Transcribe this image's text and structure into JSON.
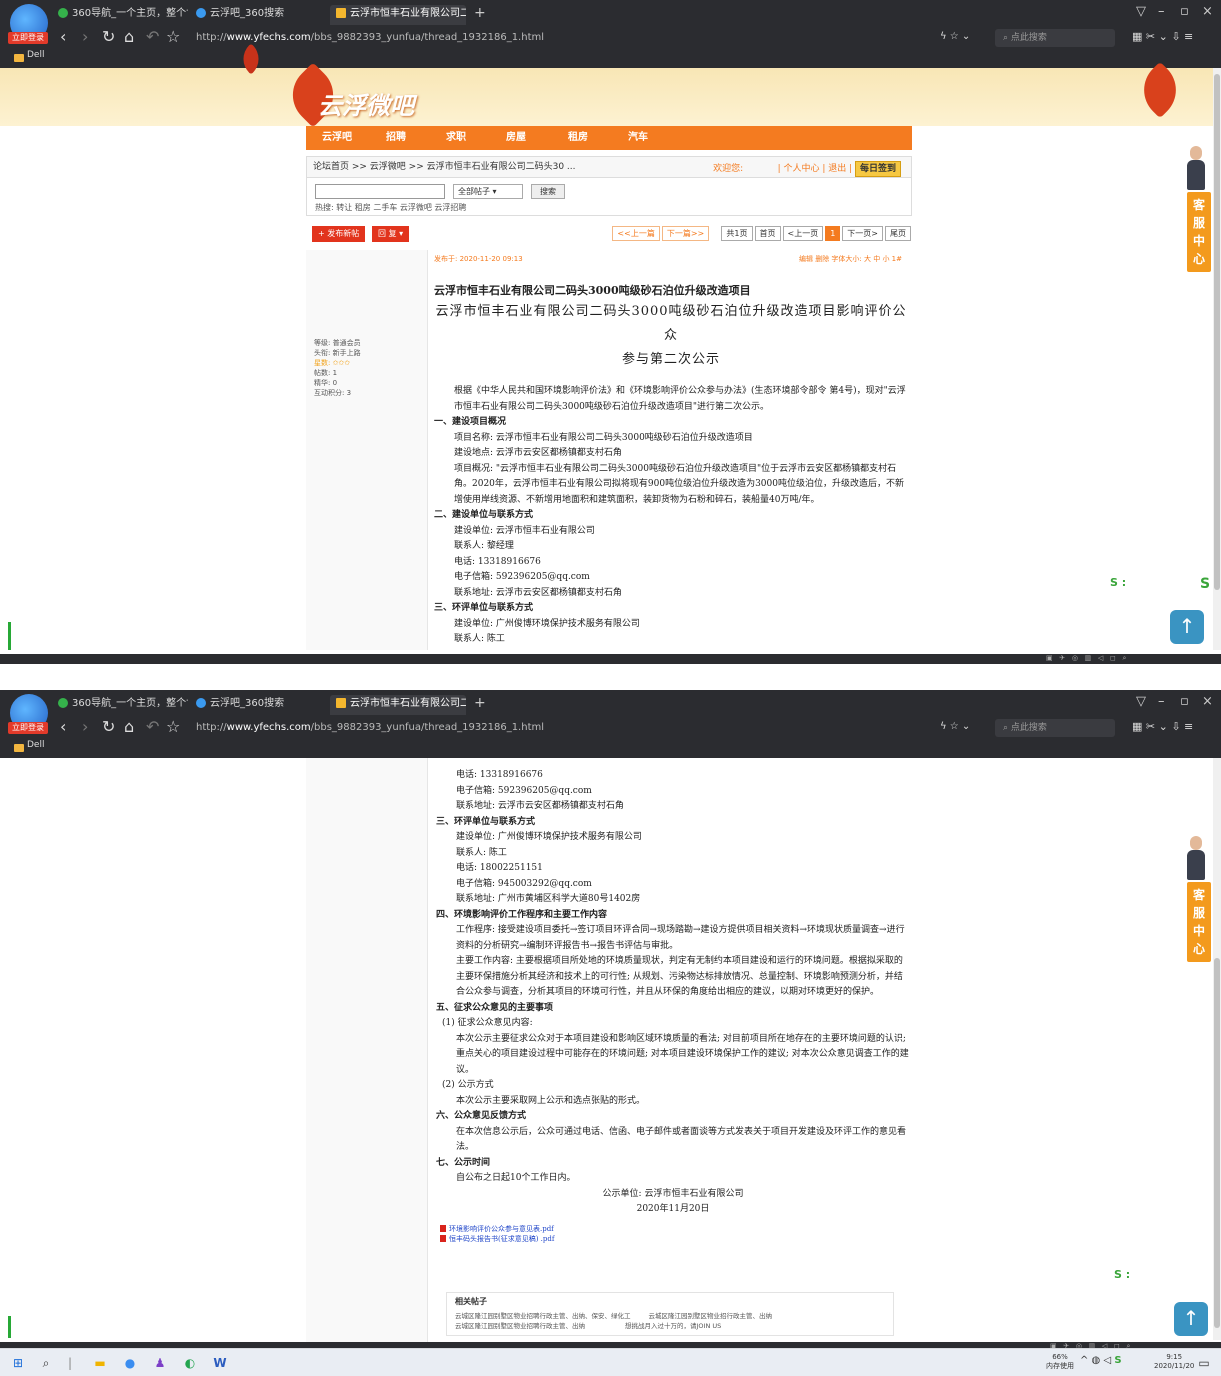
{
  "browser": {
    "login_badge": "立即登录",
    "tabs": [
      {
        "label": "360导航_一个主页，整个世界"
      },
      {
        "label": "云浮吧_360搜索"
      },
      {
        "label": "云浮市恒丰石业有限公司二码"
      }
    ],
    "url_prefix": "http://",
    "url_host": "www.yfechs.com",
    "url_path": "/bbs_9882393_yunfua/thread_1932186_1.html",
    "search_placeholder": "点此搜索",
    "bookmark": "Dell"
  },
  "site": {
    "banner_title": "云浮微吧",
    "nav": [
      "云浮吧",
      "招聘",
      "求职",
      "房屋",
      "租房",
      "汽车"
    ],
    "breadcrumb": "论坛首页 >> 云浮微吧 >> 云浮市恒丰石业有限公司二码头30 ...",
    "welcome": "欢迎您:",
    "user_center": "| 个人中心 | 退出 |",
    "checkin": "每日签到",
    "search_select": "全部帖子",
    "search_button": "搜索",
    "hot": "热搜:   转让  租房  二手车  云浮微吧  云浮招聘",
    "post_new": "+ 发布新帖",
    "reply": "回 复 ▾",
    "pager": [
      "<<上一篇",
      "下一篇>>",
      "共1页",
      "首页",
      "<上一页",
      "1",
      "下一页>",
      "尾页"
    ]
  },
  "user": {
    "lines": [
      "等级: 普通会员",
      "头衔: 新手上路",
      "星数: ✩✩✩",
      "帖数: 1",
      "精华: 0",
      "互动积分: 3"
    ]
  },
  "post": {
    "date": "发布于: 2020-11-20 09:13",
    "tools": "编辑  删除   字体大小: 大 中 小 1#",
    "title": "云浮市恒丰石业有限公司二码头3000吨级砂石泊位升级改造项目",
    "subtitle1": "云浮市恒丰石业有限公司二码头3000吨级砂石泊位升级改造项目影响评价公众",
    "subtitle2": "参与第二次公示",
    "intro": "根据《中华人民共和国环境影响评价法》和《环境影响评价公众参与办法》(生态环境部令部令 第4号)，现对\"云浮市恒丰石业有限公司二码头3000吨级砂石泊位升级改造项目\"进行第二次公示。",
    "s1": "一、建设项目概况",
    "s1_name": "项目名称: 云浮市恒丰石业有限公司二码头3000吨级砂石泊位升级改造项目",
    "s1_site": "建设地点: 云浮市云安区都杨镇都支村石角",
    "s1_desc": "项目概况: \"云浮市恒丰石业有限公司二码头3000吨级砂石泊位升级改造项目\"位于云浮市云安区都杨镇都支村石角。2020年，云浮市恒丰石业有限公司拟将现有900吨位级泊位升级改造为3000吨位级泊位，升级改造后，不新增使用岸线资源、不新增用地面积和建筑面积，装卸货物为石粉和碎石，装船量40万吨/年。",
    "s2": "二、建设单位与联系方式",
    "s2_unit": "建设单位: 云浮市恒丰石业有限公司",
    "s2_contact": "联系人: 黎经理",
    "s2_phone": "电话: 13318916676",
    "s2_email": "电子信箱: 592396205@qq.com",
    "s2_addr": "联系地址: 云浮市云安区都杨镇都支村石角",
    "s3": "三、环评单位与联系方式",
    "s3_unit": "建设单位: 广州俊博环境保护技术服务有限公司",
    "s3_contact": "联系人: 陈工",
    "s3_phone": "电话: 18002251151",
    "s3_email": "电子信箱: 945003292@qq.com",
    "s3_addr": "联系地址: 广州市黄埔区科学大道80号1402房",
    "s4": "四、环境影响评价工作程序和主要工作内容",
    "s4_proc": "工作程序: 接受建设项目委托→签订项目环评合同→现场踏勘→建设方提供项目相关资料→环境现状质量调查→进行资料的分析研究→编制环评报告书→报告书评估与审批。",
    "s4_main": "主要工作内容: 主要根据项目所处地的环境质量现状，判定有无制约本项目建设和运行的环境问题。根据拟采取的主要环保措施分析其经济和技术上的可行性; 从规划、污染物达标排放情况、总量控制、环境影响预测分析，并结合公众参与调查，分析其项目的环境可行性，并且从环保的角度给出相应的建议，以期对环境更好的保护。",
    "s5": "五、征求公众意见的主要事项",
    "s5_1": "(1) 征求公众意见内容:",
    "s5_1_text": "本次公示主要征求公众对于本项目建设和影响区域环境质量的看法; 对目前项目所在地存在的主要环境问题的认识; 重点关心的项目建设过程中可能存在的环境问题; 对本项目建设环境保护工作的建议; 对本次公众意见调查工作的建议。",
    "s5_2": "(2) 公示方式",
    "s5_2_text": "本次公示主要采取网上公示和选点张贴的形式。",
    "s6": "六、公众意见反馈方式",
    "s6_text": "在本次信息公示后，公众可通过电话、信函、电子邮件或者面谈等方式发表关于项目开发建设及环评工作的意见看法。",
    "s7": "七、公示时间",
    "s7_text": "自公布之日起10个工作日内。",
    "sign": "公示单位: 云浮市恒丰石业有限公司",
    "sign_date": "2020年11月20日",
    "att1": "环境影响评价公众参与意见表.pdf",
    "att2": "恒丰码头报告书(征求意见稿) .pdf"
  },
  "related": {
    "title": "相关帖子",
    "row1a": "云城区隆江园别墅区物业招聘行政主管、出纳、保安、绿化工",
    "row1b": "云城区隆江园别墅区物业招行政主管、出纳",
    "row2a": "云城区隆江园别墅区物业招聘行政主管、出纳",
    "row2b": "想挑战月入过十万的，请JOIN US"
  },
  "side": {
    "service": [
      "客",
      "服",
      "中",
      "心"
    ],
    "to_top": "↑"
  },
  "taskbar": {
    "mem": "66%",
    "mem_label": "内存使用",
    "time": "9:15",
    "date": "2020/11/20"
  }
}
